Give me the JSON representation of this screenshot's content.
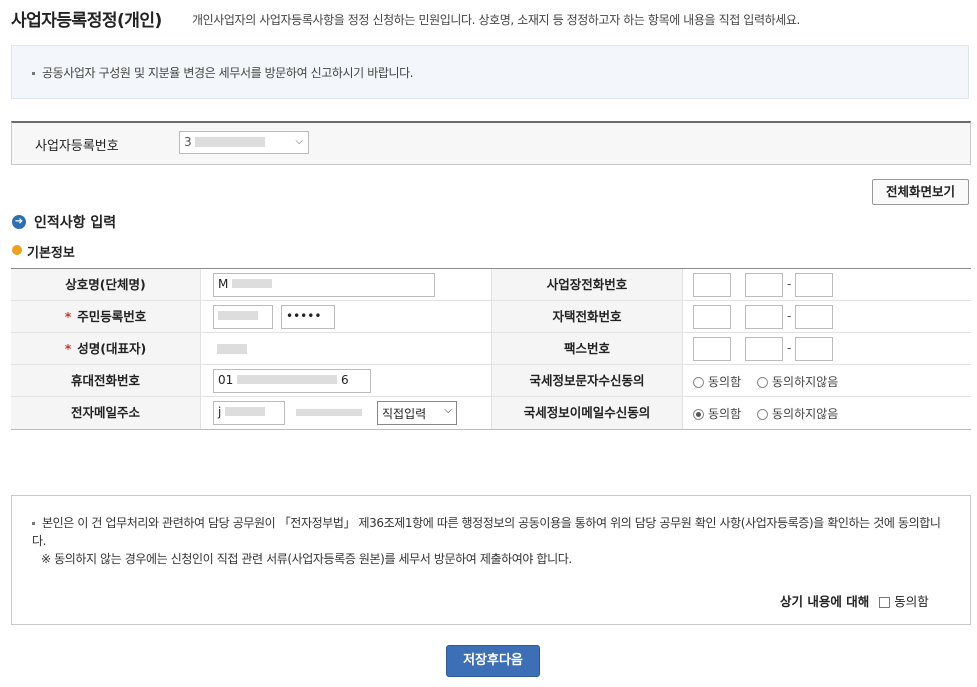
{
  "header": {
    "title": "사업자등록정정(개인)",
    "description": "개인사업자의 사업자등록사항을 정정 신청하는 민원입니다. 상호명, 소재지 등 정정하고자 하는 항목에 내용을 직접 입력하세요."
  },
  "notice": {
    "text": "공동사업자 구성원 및 지분율 변경은 세무서를 방문하여 신고하시기 바랍니다."
  },
  "business": {
    "label": "사업자등록번호",
    "value": "3"
  },
  "toolbar": {
    "full_view_label": "전체화면보기"
  },
  "section": {
    "title": "인적사항 입력",
    "subtitle": "기본정보",
    "required_mark": "*"
  },
  "form": {
    "rows": [
      {
        "left_label": "상호명(단체명)",
        "right_label": "사업장전화번호"
      },
      {
        "left_label": "주민등록번호",
        "right_label": "자택전화번호"
      },
      {
        "left_label": "성명(대표자)",
        "right_label": "팩스번호"
      },
      {
        "left_label": "휴대전화번호",
        "right_label": "국세정보문자수신동의"
      },
      {
        "left_label": "전자메일주소",
        "right_label": "국세정보이메일수신동의"
      }
    ],
    "trade_name_value": "M",
    "rrn_masked": "•••••",
    "mobile_prefix": "01",
    "mobile_suffix": "6",
    "email_local": "j",
    "email_domain_select": "직접입력",
    "dash": "-",
    "sms_agree": "동의함",
    "sms_disagree": "동의하지않음",
    "email_agree": "동의함",
    "email_disagree": "동의하지않음"
  },
  "consent": {
    "text": "본인은 이 건 업무처리와 관련하여 담당 공무원이 「전자정부법」 제36조제1항에 따른 행정정보의 공동이용을 통하여 위의 담당 공무원 확인 사항(사업자등록증)을 확인하는 것에 동의합니다.",
    "note": "※  동의하지 않는 경우에는 신청인이 직접 관련 서류(사업자등록증 원본)를 세무서 방문하여 제출하여야 합니다.",
    "agree_question": "상기 내용에 대해",
    "agree_label": "동의함"
  },
  "footer": {
    "save_label": "저장후다음"
  },
  "colors": {
    "primary_button": "#3d6fb6",
    "required": "#c0392b",
    "section_icon": "#2c6fb3",
    "subsection_icon": "#f0a020"
  }
}
